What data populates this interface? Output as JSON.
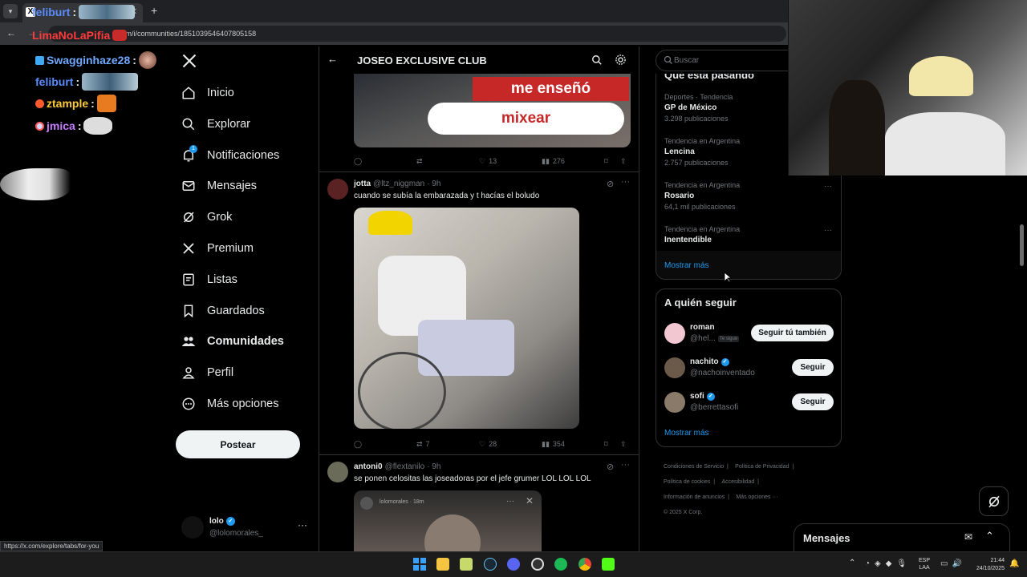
{
  "browser": {
    "url": "x.com/i/communities/1851039546407805158",
    "status_url": "https://x.com/explore/tabs/for-you"
  },
  "chat": [
    {
      "user": "feliburt",
      "color": "#5b8cff"
    },
    {
      "user": "LimaNoLaPifia",
      "color": "#ff3b3b"
    },
    {
      "user": "Swagginhaze28",
      "color": "#6fa8ff"
    },
    {
      "user": "feliburt",
      "color": "#5b8cff"
    },
    {
      "user": "ztample",
      "color": "#ffcc33"
    },
    {
      "user": "jmica",
      "color": "#c77dff"
    }
  ],
  "nav": {
    "items": [
      {
        "label": "Inicio",
        "icon": "home-icon"
      },
      {
        "label": "Explorar",
        "icon": "search-icon"
      },
      {
        "label": "Notificaciones",
        "icon": "bell-icon",
        "badge": "1"
      },
      {
        "label": "Mensajes",
        "icon": "mail-icon"
      },
      {
        "label": "Grok",
        "icon": "grok-icon"
      },
      {
        "label": "Premium",
        "icon": "x-logo-icon"
      },
      {
        "label": "Listas",
        "icon": "list-icon"
      },
      {
        "label": "Guardados",
        "icon": "bookmark-icon"
      },
      {
        "label": "Comunidades",
        "icon": "communities-icon",
        "active": true
      },
      {
        "label": "Perfil",
        "icon": "person-icon"
      },
      {
        "label": "Más opciones",
        "icon": "more-circle-icon"
      }
    ],
    "post_label": "Postear",
    "account": {
      "name": "lolo",
      "handle": "@lolomorales_"
    }
  },
  "feed": {
    "header_title": "JOSEO EXCLUSIVE CLUB",
    "top_post": {
      "caption_line1": "me enseñó",
      "caption_line2": "mixear",
      "likes": "13",
      "views": "276"
    },
    "posts": [
      {
        "name": "jotta",
        "handle": "@ltz_niggman",
        "time": "· 9h",
        "text": "cuando se subía la embarazada y t hacías el boludo",
        "reposts": "7",
        "likes": "28",
        "views": "354"
      },
      {
        "name": "antoni0",
        "handle": "@flextanilo",
        "time": "· 9h",
        "text": "se ponen celositas las joseadoras por el jefe grumer LOL LOL LOL",
        "embed_handle": "lolomorales · 18m"
      }
    ]
  },
  "right": {
    "search_placeholder": "Buscar",
    "trends_title": "Qué está pasando",
    "trends": [
      {
        "context": "Deportes · Tendencia",
        "title": "GP de México",
        "count": "3.298 publicaciones"
      },
      {
        "context": "Tendencia en Argentina",
        "title": "Lencina",
        "count": "2.757 publicaciones"
      },
      {
        "context": "Tendencia en Argentina",
        "title": "Rosario",
        "count": "64,1 mil publicaciones"
      },
      {
        "context": "Tendencia en Argentina",
        "title": "Inentendible",
        "count": ""
      }
    ],
    "show_more": "Mostrar más",
    "who_title": "A quién seguir",
    "who": [
      {
        "name": "roman",
        "handle": "@hel...",
        "badge": "Te sigue",
        "button": "Seguir tú también",
        "verified": false
      },
      {
        "name": "nachito",
        "handle": "@nachoinventado",
        "button": "Seguir",
        "verified": true
      },
      {
        "name": "sofi",
        "handle": "@berrettasofi",
        "button": "Seguir",
        "verified": true
      }
    ],
    "who_more": "Mostrar más",
    "footer": [
      "Condiciones de Servicio",
      "Política de Privacidad",
      "Política de cookies",
      "Accesibilidad",
      "Información de anuncios",
      "Más opciones ···",
      "© 2025 X Corp."
    ]
  },
  "messages_drawer": {
    "title": "Mensajes"
  },
  "taskbar": {
    "lang1": "ESP",
    "lang2": "LAA",
    "time": "21:44",
    "date": "24/10/2025"
  }
}
